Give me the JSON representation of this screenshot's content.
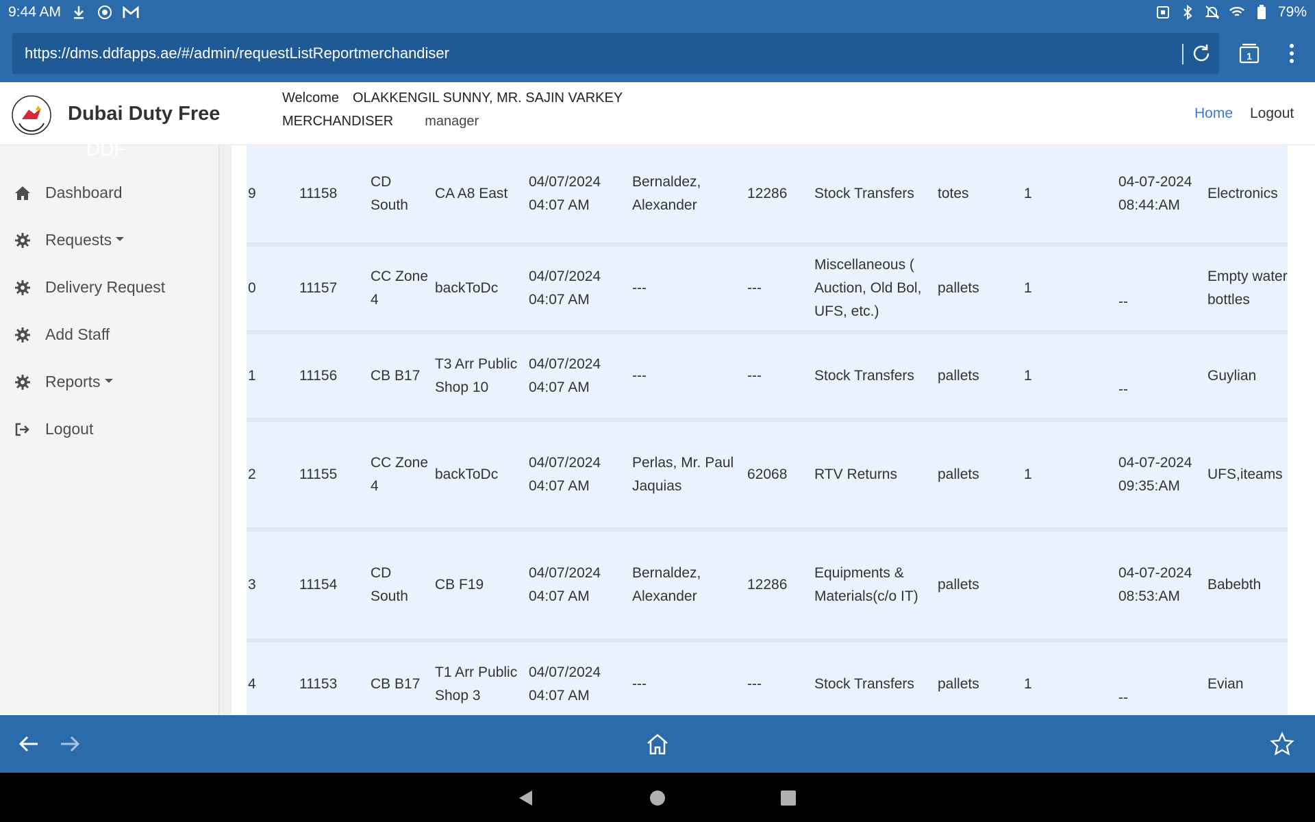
{
  "status_bar": {
    "time": "9:44 AM",
    "battery": "79%"
  },
  "browser": {
    "url": "https://dms.ddfapps.ae/#/admin/requestListReportmerchandiser",
    "tab_count": "1"
  },
  "header": {
    "brand": "Dubai Duty Free",
    "welcome_label": "Welcome",
    "user_name": "OLAKKENGIL SUNNY, MR. SAJIN VARKEY",
    "role": "MERCHANDISER",
    "level": "manager",
    "nav_home": "Home",
    "nav_logout": "Logout"
  },
  "sidebar": {
    "ghost_text": "DDF",
    "items": [
      {
        "label": "Dashboard",
        "icon": "home-icon"
      },
      {
        "label": "Requests",
        "icon": "gear-icon"
      },
      {
        "label": "Delivery Request",
        "icon": "gear-icon"
      },
      {
        "label": "Add Staff",
        "icon": "gear-icon"
      },
      {
        "label": "Reports",
        "icon": "gear-icon"
      },
      {
        "label": "Logout",
        "icon": "sign-out-icon"
      }
    ]
  },
  "table": {
    "rows": [
      {
        "idx": "9",
        "id": "11158",
        "from": "CD South",
        "to": "CA A8 East",
        "created": "04/07/2024 04:07 AM",
        "driver": "Bernaldez, Alexander",
        "staff_no": "12286",
        "type": "Stock Transfers",
        "unit": "totes",
        "qty": "1",
        "delivered": "04-07-2024 08:44:AM",
        "remarks": "Electronics"
      },
      {
        "idx": "0",
        "id": "11157",
        "from": "CC Zone 4",
        "to": "backToDc",
        "created": "04/07/2024 04:07 AM",
        "driver": "---",
        "staff_no": "---",
        "type": "Miscellaneous ( Auction, Old Bol, UFS, etc.)",
        "unit": "pallets",
        "qty": "1",
        "delivered": "--",
        "remarks": "Empty water bottles"
      },
      {
        "idx": "1",
        "id": "11156",
        "from": "CB B17",
        "to": "T3 Arr Public Shop 10",
        "created": "04/07/2024 04:07 AM",
        "driver": "---",
        "staff_no": "---",
        "type": "Stock Transfers",
        "unit": "pallets",
        "qty": "1",
        "delivered": "--",
        "remarks": "Guylian"
      },
      {
        "idx": "2",
        "id": "11155",
        "from": "CC Zone 4",
        "to": "backToDc",
        "created": "04/07/2024 04:07 AM",
        "driver": "Perlas, Mr. Paul Jaquias",
        "staff_no": "62068",
        "type": "RTV Returns",
        "unit": "pallets",
        "qty": "1",
        "delivered": "04-07-2024 09:35:AM",
        "remarks": "UFS,iteams"
      },
      {
        "idx": "3",
        "id": "11154",
        "from": "CD South",
        "to": "CB F19",
        "created": "04/07/2024 04:07 AM",
        "driver": "Bernaldez, Alexander",
        "staff_no": "12286",
        "type": "Equipments & Materials(c/o IT)",
        "unit": "pallets",
        "qty": "",
        "delivered": "04-07-2024 08:53:AM",
        "remarks": "Babebth"
      },
      {
        "idx": "4",
        "id": "11153",
        "from": "CB B17",
        "to": "T1 Arr Public Shop 3",
        "created": "04/07/2024 04:07 AM",
        "driver": "---",
        "staff_no": "---",
        "type": "Stock Transfers",
        "unit": "pallets",
        "qty": "1",
        "delivered": "--",
        "remarks": "Evian"
      }
    ]
  }
}
